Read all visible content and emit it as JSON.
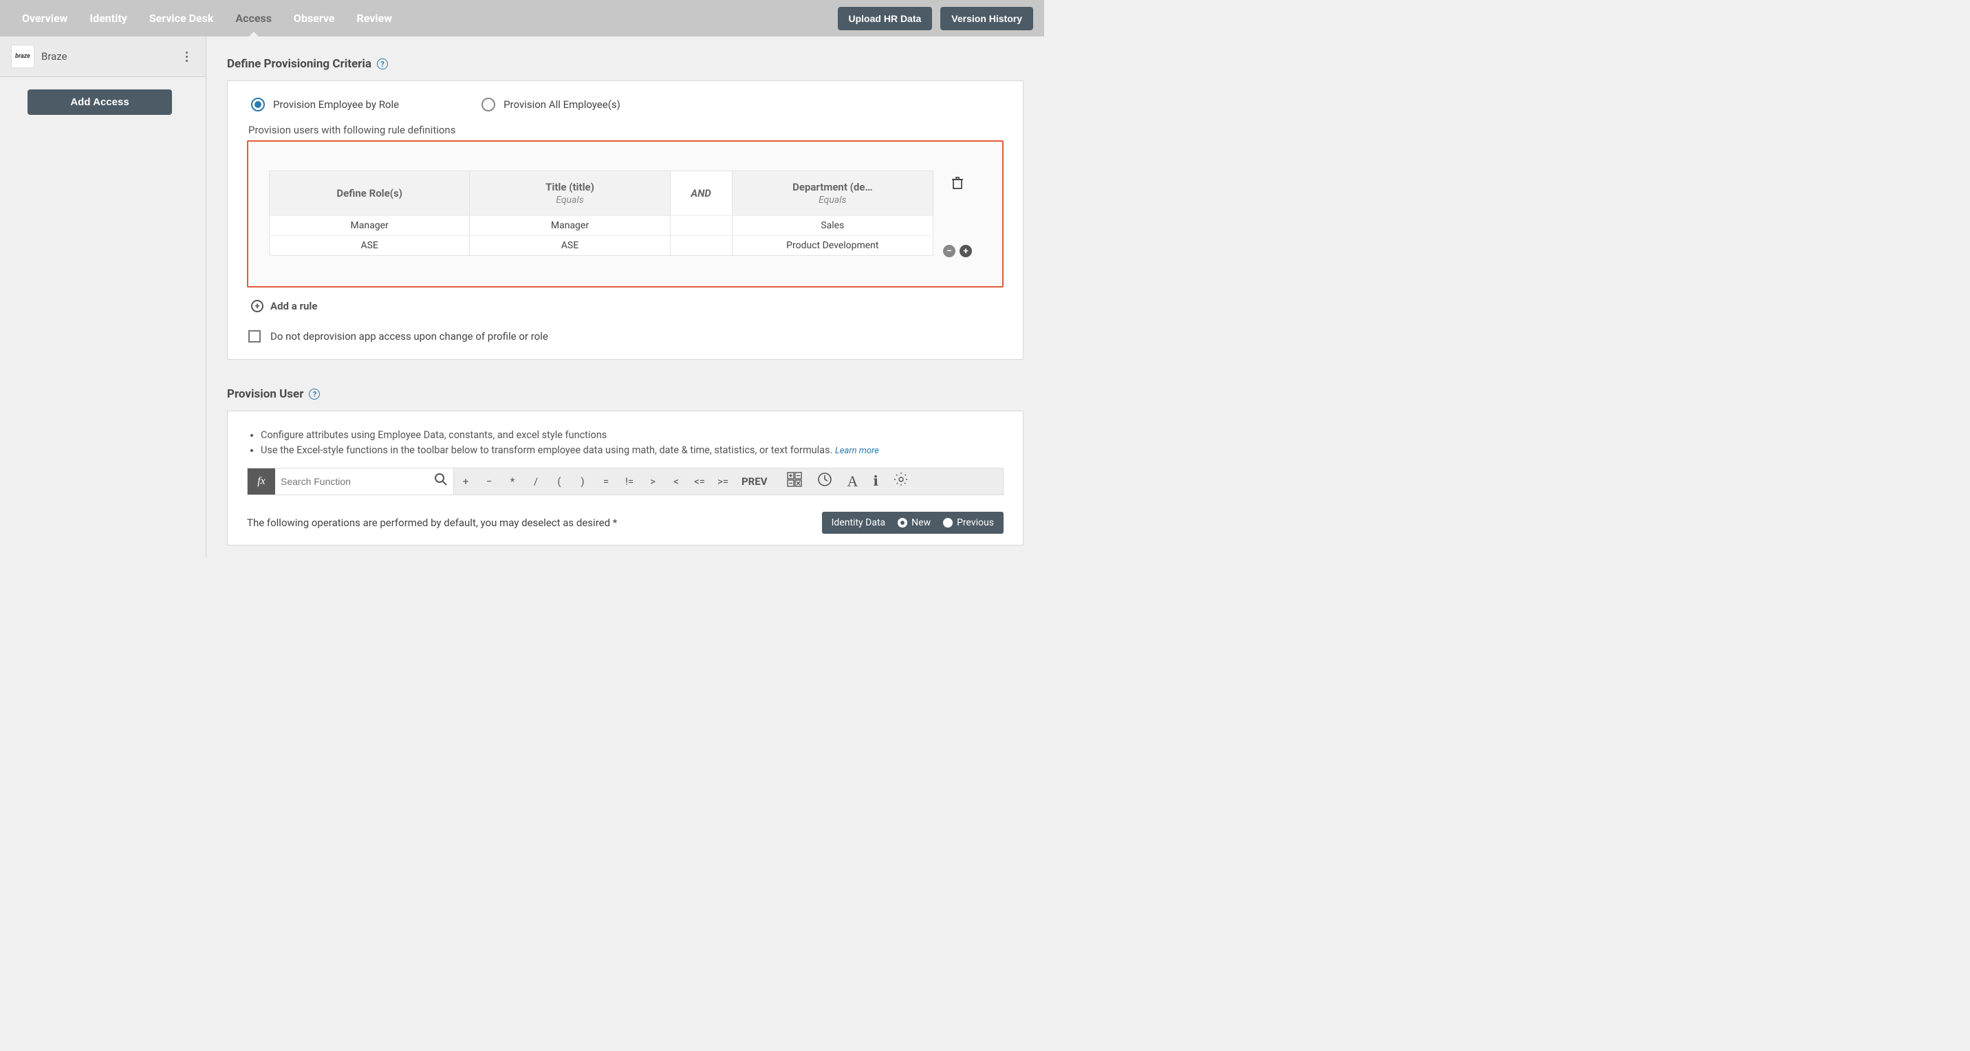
{
  "topbar": {
    "tabs": [
      "Overview",
      "Identity",
      "Service Desk",
      "Access",
      "Observe",
      "Review"
    ],
    "active_index": 3,
    "upload_btn": "Upload HR Data",
    "version_btn": "Version History"
  },
  "sidebar": {
    "app_logo_text": "braze",
    "app_name": "Braze",
    "add_access_btn": "Add Access"
  },
  "criteria": {
    "title": "Define Provisioning Criteria",
    "radio_by_role": "Provision Employee by Role",
    "radio_all": "Provision All Employee(s)",
    "radio_selected": "by_role",
    "subhead": "Provision users with following rule definitions",
    "table": {
      "col_role": "Define Role(s)",
      "col_title": "Title (title)",
      "col_title_sub": "Equals",
      "col_and": "AND",
      "col_dept": "Department (de…",
      "col_dept_sub": "Equals",
      "rows": [
        {
          "role": "Manager",
          "title": "Manager",
          "dept": "Sales"
        },
        {
          "role": "ASE",
          "title": "ASE",
          "dept": "Product Development"
        }
      ]
    },
    "add_rule": "Add a rule",
    "checkbox_label": "Do not deprovision app access upon change of profile or role"
  },
  "provision": {
    "title": "Provision User",
    "bullets": [
      "Configure attributes using Employee Data, constants, and excel style functions",
      "Use the Excel-style functions in the toolbar below to transform employee data using math, date & time, statistics, or text formulas."
    ],
    "learn_more": "Learn more",
    "fx_label": "fx",
    "search_placeholder": "Search Function",
    "ops": [
      "+",
      "−",
      "*",
      "/",
      "(",
      ")",
      "=",
      "!=",
      ">",
      "<",
      "<=",
      ">="
    ],
    "prev_label": "PREV",
    "bottom_note": "The following operations are performed by default, you may deselect as desired *",
    "identity_label": "Identity Data",
    "identity_new": "New",
    "identity_prev": "Previous"
  }
}
